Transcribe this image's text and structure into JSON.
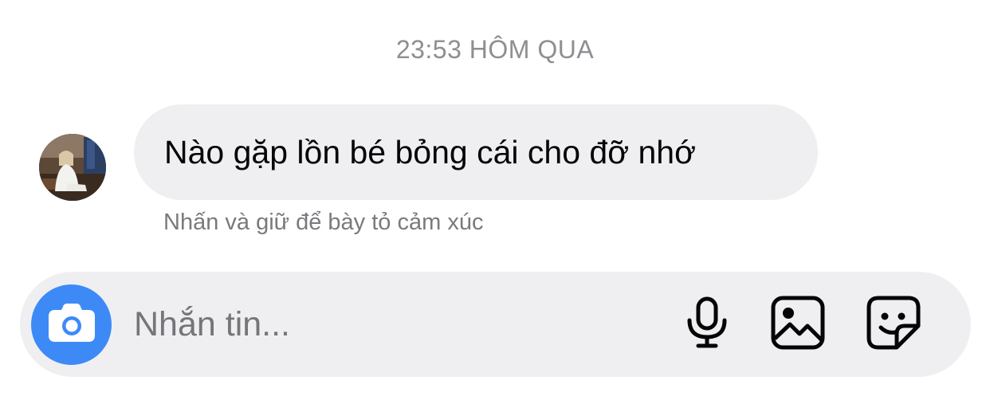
{
  "conversation": {
    "timestamp": "23:53 HÔM QUA",
    "message": {
      "text": "Nào gặp lồn bé bỏng cái cho đỡ nhớ",
      "hint": "Nhấn và giữ để bày tỏ cảm xúc"
    }
  },
  "composer": {
    "placeholder": "Nhắn tin...",
    "value": "",
    "icons": {
      "camera": "camera-icon",
      "microphone": "microphone-icon",
      "gallery": "image-icon",
      "sticker": "sticker-icon"
    }
  },
  "colors": {
    "accent": "#3d8af7",
    "bubble": "#efeff2",
    "text_primary": "#050505",
    "text_secondary": "#8e8e93"
  }
}
